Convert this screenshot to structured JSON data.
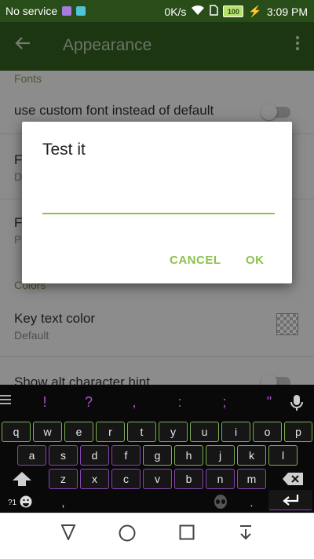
{
  "status": {
    "carrier": "No service",
    "speed": "0K/s",
    "battery": "100",
    "time": "3:09 PM"
  },
  "appbar": {
    "title": "Appearance"
  },
  "settings": {
    "category_fonts": "Fonts",
    "custom_font_title": "use custom font instead of default",
    "font_row1_initial": "F",
    "font_row1_sub_initial": "D",
    "font_row2_initial": "F",
    "font_row2_sub_initial": "P",
    "category_colors": "Colors",
    "key_text_color_title": "Key text color",
    "key_text_color_value": "Default",
    "alt_hint_title": "Show alt character hint"
  },
  "dialog": {
    "title": "Test it",
    "input_value": "",
    "cancel_label": "CANCEL",
    "ok_label": "OK"
  },
  "keyboard": {
    "suggestions": [
      "!",
      "?",
      ",",
      ":",
      ";",
      "\""
    ],
    "row1": [
      "q",
      "w",
      "e",
      "r",
      "t",
      "y",
      "u",
      "i",
      "o",
      "p"
    ],
    "row2": [
      "a",
      "s",
      "d",
      "f",
      "g",
      "h",
      "j",
      "k",
      "l"
    ],
    "row3": [
      "z",
      "x",
      "c",
      "v",
      "b",
      "n",
      "m"
    ],
    "symbols_label": "?1",
    "comma_label": ",",
    "period_label": "."
  }
}
